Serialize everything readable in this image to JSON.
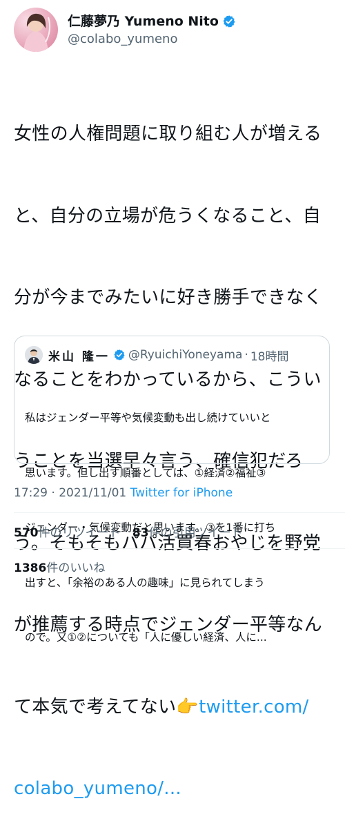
{
  "author": {
    "display_name": "仁藤夢乃  Yumeno Nito",
    "handle": "@colabo_yumeno",
    "verified_icon": "verified-badge-icon",
    "avatar_color": "#e9a9bc"
  },
  "tweet": {
    "lines": [
      "女性の人権問題に取り組む人が増える",
      "と、自分の立場が危うくなること、自",
      "分が今までみたいに好き勝手できなく",
      "なることをわかっているから、こうい",
      "うことを当選早々言う、確信犯だろ",
      "う。そもそもパパ活買春おやじを野党",
      "が推薦する時点でジェンダー平等なん"
    ],
    "line8_text": "て本気で考えてない",
    "pointing_emoji": "👉",
    "link_part1": "twitter.com/",
    "link_part2": "colabo_yumeno/...",
    "link_color": "#1d9bf0"
  },
  "quoted_tweet": {
    "name": "米山 隆一",
    "handle": "@RyuichiYoneyama",
    "separator": "·",
    "time": "18時間",
    "lines": [
      "私はジェンダー平等や気候変動も出し続けていいと",
      "思います。但し出す順番としては、①経済②福祉③",
      "ジェンダー・気候変動だと思います。③を1番に打ち",
      "出すと、「余裕のある人の趣味」に見られてしまう",
      "ので。又①②についても「人に優しい経済、人に..."
    ]
  },
  "meta": {
    "time": "17:29",
    "separator": "·",
    "date": "2021/11/01",
    "source": "Twitter for iPhone"
  },
  "stats": {
    "retweets_count": "570",
    "retweets_label": "件のリツイート",
    "quotes_count": "83",
    "quotes_label": "件の引用ツイート",
    "likes_count": "1386",
    "likes_label": "件のいいね"
  }
}
